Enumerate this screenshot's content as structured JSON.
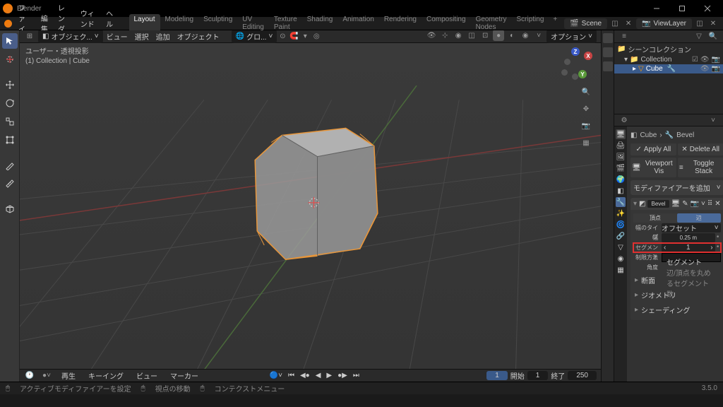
{
  "titlebar": {
    "title": "Blender"
  },
  "menubar": {
    "logo": "blender-icon",
    "items": [
      "ファイル",
      "編集",
      "レンダー",
      "ウィンドウ",
      "ヘルプ"
    ],
    "workspace_tabs": [
      "Layout",
      "Modeling",
      "Sculpting",
      "UV Editing",
      "Texture Paint",
      "Shading",
      "Animation",
      "Rendering",
      "Compositing",
      "Geometry Nodes",
      "Scripting"
    ],
    "active_workspace": 0,
    "scene_label": "Scene",
    "viewlayer_label": "ViewLayer"
  },
  "header2": {
    "mode": "オブジェク...",
    "menus": [
      "ビュー",
      "選択",
      "追加",
      "オブジェクト"
    ],
    "snap_label": "グロ...",
    "options_label": "オプション"
  },
  "viewport": {
    "info_line1": "ユーザー・透視投影",
    "info_line2": "(1) Collection | Cube"
  },
  "timeline": {
    "menus": [
      "再生",
      "キーイング",
      "ビュー",
      "マーカー"
    ],
    "current": "1",
    "start_label": "開始",
    "start_val": "1",
    "end_label": "終了",
    "end_val": "250"
  },
  "status": {
    "left1": "アクティブモディファイアーを設定",
    "left2": "視点の移動",
    "left3": "コンテクストメニュー",
    "version": "3.5.0"
  },
  "outliner": {
    "header": "シーンコレクション",
    "collection": "Collection",
    "cube": "Cube"
  },
  "props": {
    "breadcrumb_obj": "Cube",
    "breadcrumb_mod": "Bevel",
    "apply_all": "Apply All",
    "delete_all": "Delete All",
    "viewport_vis": "Viewport Vis",
    "toggle_stack": "Toggle Stack",
    "add_modifier_label": "モディファイアーを追加",
    "mod_name": "Bevel",
    "vertex_btn": "頂点",
    "edge_btn": "辺",
    "width_type_label": "幅のタイプ",
    "width_type_val": "オフセット",
    "width_label": "幅",
    "width_val": "0.25 m",
    "segments_label": "セグメント",
    "segments_val": "1",
    "limit_label": "制限方法",
    "angle_label": "角度",
    "tooltip_title": "セグメント",
    "tooltip_desc": "辺/頂点を丸めるセグメント数.",
    "sub_profile": "断面",
    "sub_geometry": "ジオメトリ",
    "sub_shading": "シェーディング"
  }
}
